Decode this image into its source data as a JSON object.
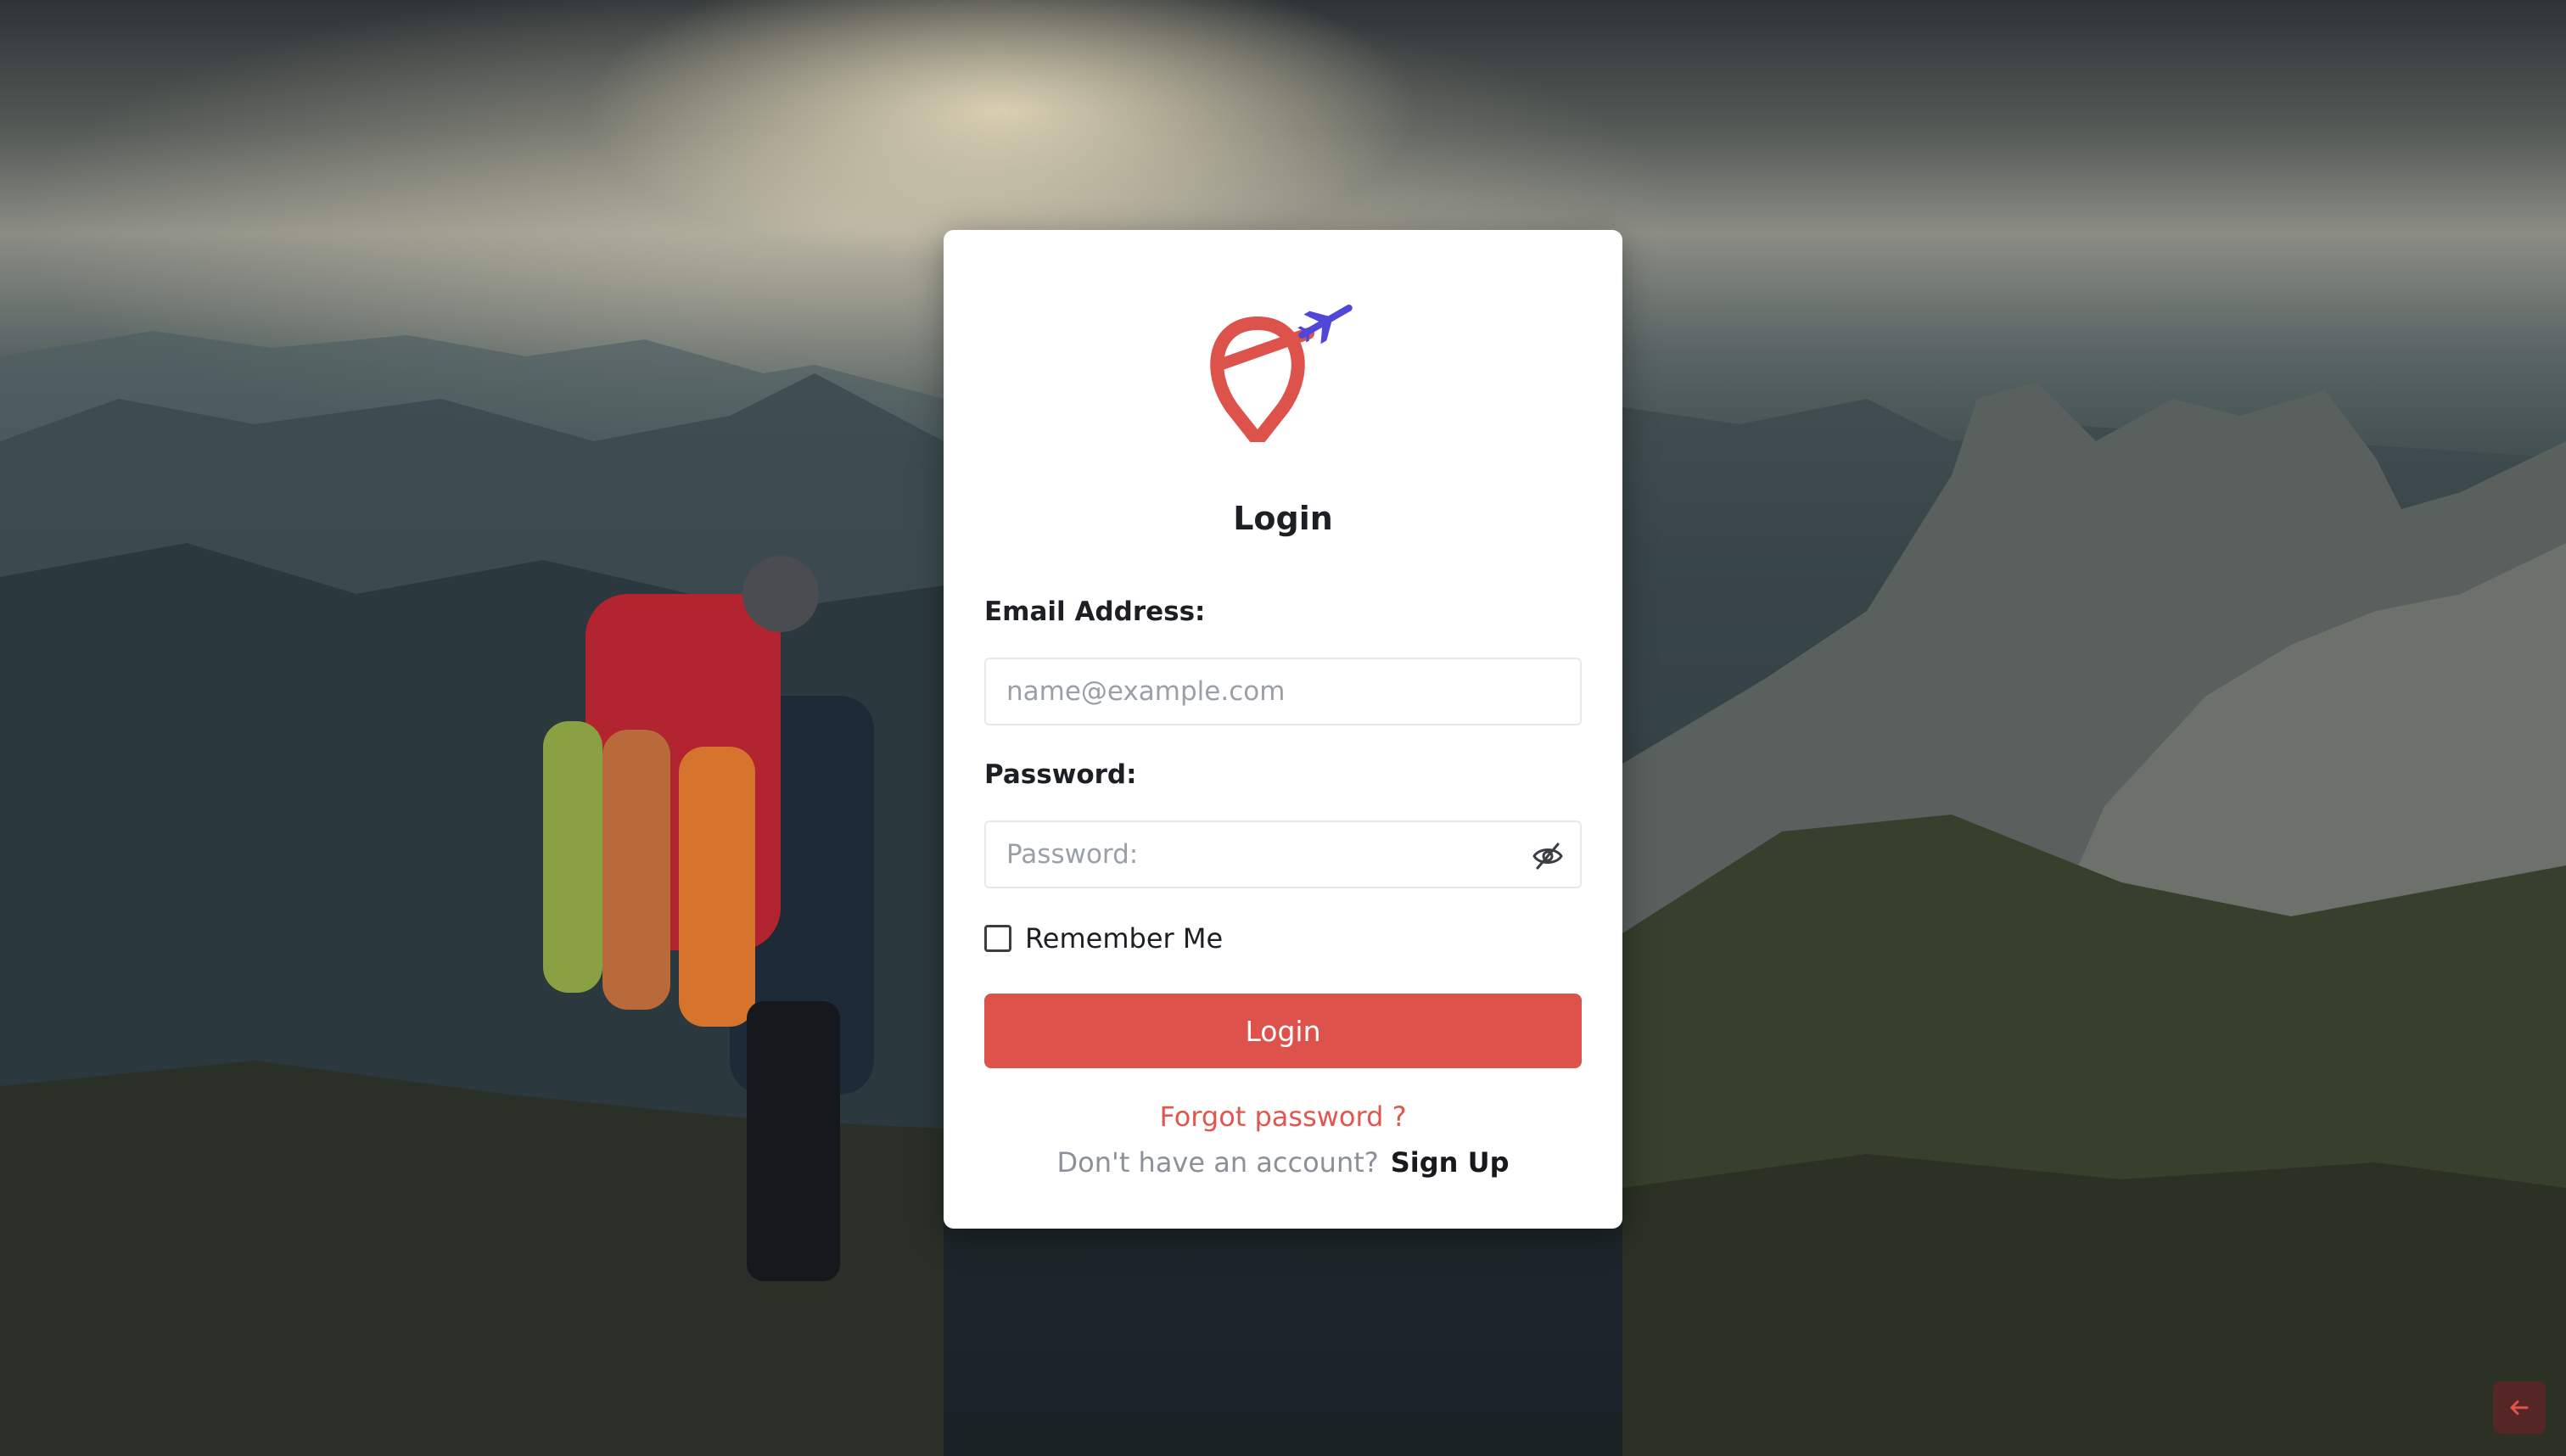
{
  "login": {
    "title": "Login",
    "email_label": "Email Address:",
    "email_placeholder": "name@example.com",
    "password_label": "Password:",
    "password_placeholder": "Password:",
    "remember_label": "Remember Me",
    "submit_label": "Login",
    "forgot_link": "Forgot password ?",
    "no_account_text": "Don't have an account?",
    "signup_link": "Sign Up"
  },
  "icons": {
    "logo": "map-pin-airplane-logo",
    "password_toggle": "eye-off-icon",
    "back": "arrow-left-icon"
  },
  "colors": {
    "brand_red": "#dd524b",
    "brand_purple": "#5046d8",
    "card": "#ffffff"
  }
}
